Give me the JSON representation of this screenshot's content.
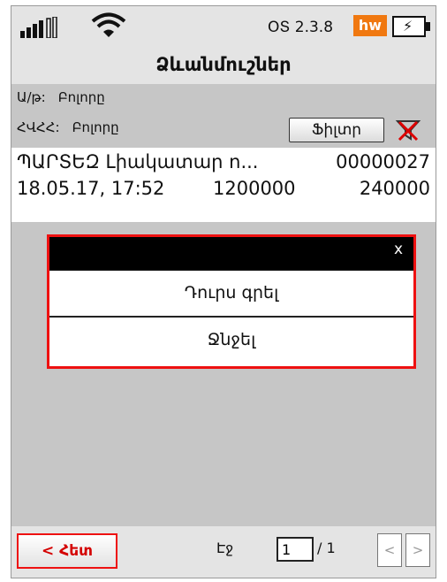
{
  "status_bar": {
    "version": "ՕՏ 2.3.8",
    "hw_badge": "hw",
    "battery_icon": "battery-charging-icon"
  },
  "header": {
    "title": "Ձևանմուշներ"
  },
  "filter": {
    "row1_label": "Ա/թ:",
    "row1_value": "Բոլորը",
    "row2_label": "ՀՎՀՀ:",
    "row2_value": "Բոլորը",
    "filter_button": "Ֆիլտր"
  },
  "document": {
    "name": "ՊԱՐՏԵԶ Լիակատար ո...",
    "number": "00000027",
    "date": "18.05.17, 17:52",
    "amount": "1200000",
    "vat": "240000"
  },
  "popup": {
    "close": "x",
    "items": [
      "Դուրս գրել",
      "Ջնջել"
    ]
  },
  "footer": {
    "back_button": "< Հետ",
    "page_label": "Էջ",
    "page_value": "1",
    "page_total": "/ 1",
    "prev": "<",
    "next": ">"
  },
  "colors": {
    "accent_red": "#ee1111",
    "hw_orange": "#f07810",
    "panel_gray": "#c6c6c6"
  }
}
